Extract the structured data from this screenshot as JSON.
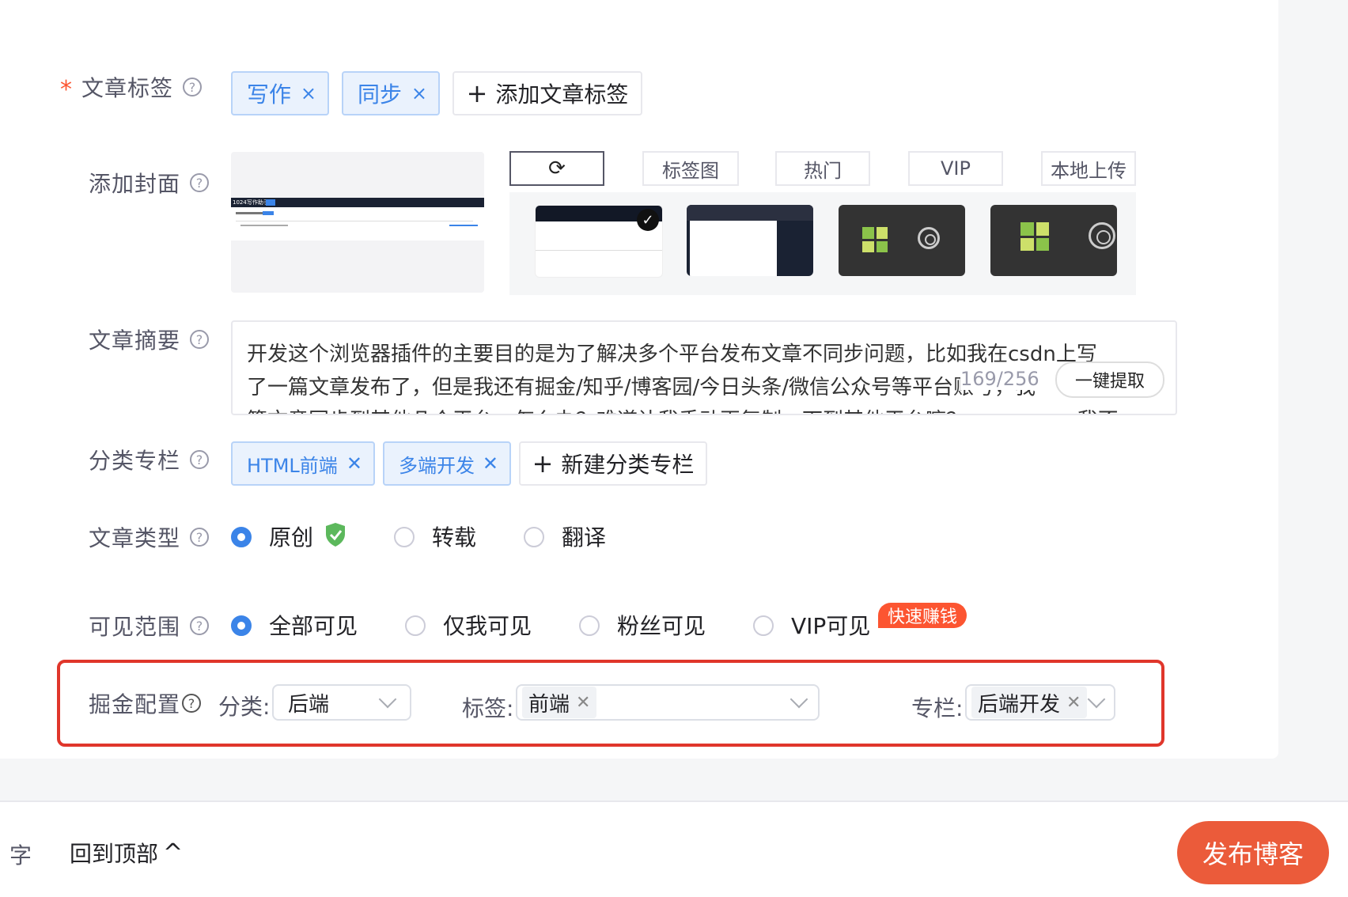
{
  "tags_row": {
    "label": "文章标签",
    "required_mark": "*",
    "help": "?",
    "tags": [
      "写作",
      "同步"
    ],
    "remove_glyph": "×",
    "add_label": "添加文章标签",
    "add_glyph": "+"
  },
  "cover": {
    "label": "添加封面",
    "help": "?",
    "refresh_glyph": "⟳",
    "sources": [
      "标签图",
      "热门",
      "VIP",
      "本地上传"
    ],
    "thumb_mini_title": "1024写作助手",
    "check_glyph": "✓"
  },
  "summary": {
    "label": "文章摘要",
    "help": "?",
    "text_line1": "开发这个浏览器插件的主要目的是为了解决多个平台发布文章不同步问题，比如我在csdn上写",
    "text_line2": "了一篇文章发布了，但是我还有掘金/知乎/博客园/今日头条/微信公众号等平台账号，我",
    "text_line3": "篇文章同步到其他几个平台，怎么办？难道让我手动再复制一下到其他平台嘛？no no no，我不",
    "counter": "169/256",
    "extract_label": "一键提取"
  },
  "category": {
    "label": "分类专栏",
    "help": "?",
    "items": [
      "HTML前端",
      "多端开发"
    ],
    "remove_glyph": "✕",
    "add_label": "新建分类专栏",
    "add_glyph": "+"
  },
  "article_type": {
    "label": "文章类型",
    "help": "?",
    "options": [
      "原创",
      "转载",
      "翻译"
    ],
    "selected": "原创"
  },
  "visibility": {
    "label": "可见范围",
    "help": "?",
    "options": [
      "全部可见",
      "仅我可见",
      "粉丝可见",
      "VIP可见"
    ],
    "selected": "全部可见",
    "badge": "快速赚钱"
  },
  "juejin": {
    "label": "掘金配置",
    "help": "?",
    "category_label": "分类:",
    "category_value": "后端",
    "tag_label": "标签:",
    "tag_value": "前端",
    "column_label": "专栏:",
    "column_value": "后端开发",
    "remove_glyph": "✕"
  },
  "footer": {
    "word_fragment": "字",
    "back_to_top": "回到顶部",
    "back_glyph": "^",
    "publish": "发布博客"
  },
  "colors": {
    "accent": "#3b84e8",
    "danger": "#fc5531",
    "publish_bg": "#eb5b3a",
    "highlight_border": "#e0362b"
  }
}
